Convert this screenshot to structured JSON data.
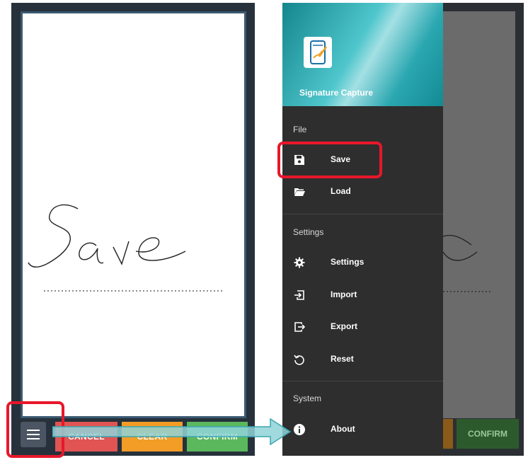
{
  "left_screen": {
    "signature_text": "Save",
    "buttons": {
      "cancel": "CANCEL",
      "clear": "CLEAR",
      "confirm": "CONFIRM"
    }
  },
  "drawer": {
    "app_title": "Signature Capture",
    "sections": [
      {
        "label": "File",
        "items": [
          {
            "label": "Save",
            "icon": "save-icon"
          },
          {
            "label": "Load",
            "icon": "folder-icon"
          }
        ]
      },
      {
        "label": "Settings",
        "items": [
          {
            "label": "Settings",
            "icon": "gear-icon"
          },
          {
            "label": "Import",
            "icon": "import-icon"
          },
          {
            "label": "Export",
            "icon": "export-icon"
          },
          {
            "label": "Reset",
            "icon": "reset-icon"
          }
        ]
      },
      {
        "label": "System",
        "items": [
          {
            "label": "About",
            "icon": "info-icon"
          }
        ]
      }
    ]
  },
  "right_screen": {
    "confirm_label": "CONFIRM"
  },
  "colors": {
    "highlight": "#e8172a",
    "cancel": "#e05454",
    "clear": "#f39c26",
    "confirm": "#5cb85c",
    "drawer_header": "#2aa7b0"
  }
}
